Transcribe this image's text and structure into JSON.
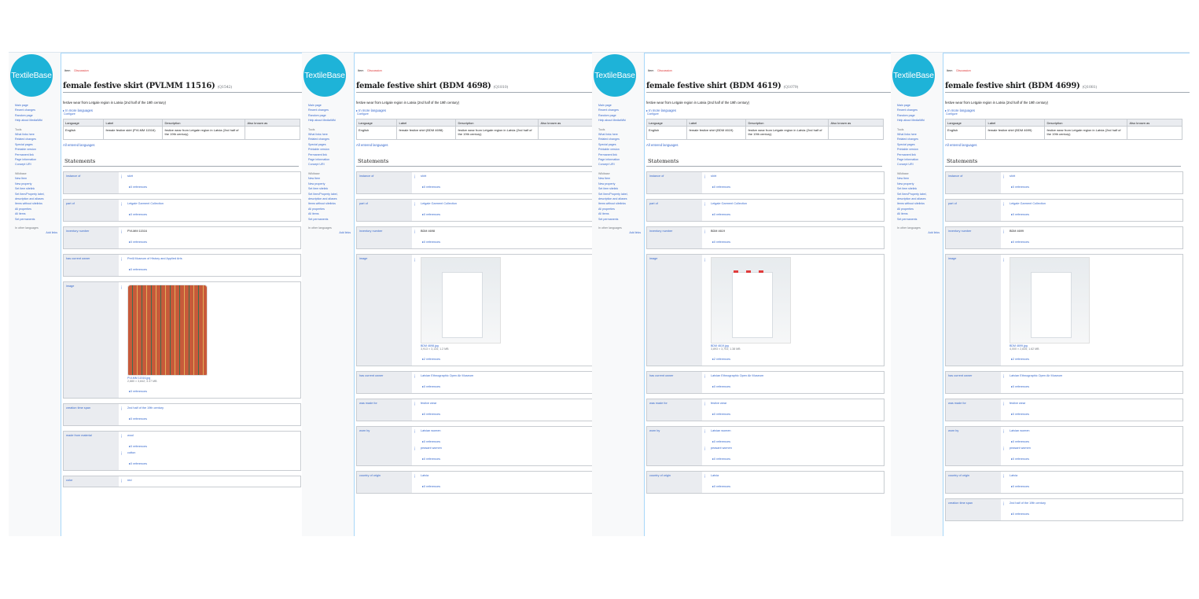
{
  "sidebar": {
    "logo": "TextileBase",
    "nav": [
      "Main page",
      "Recent changes",
      "Random page",
      "Help about MediaWiki"
    ],
    "tools_heading": "Tools",
    "tools": [
      "What links here",
      "Related changes",
      "Special pages",
      "Printable version",
      "Permanent link",
      "Page information",
      "Concept URI"
    ],
    "wikibase_heading": "Wikibase",
    "wikibase": [
      "New Item",
      "New property",
      "Set item sitelink",
      "Set Item/Property label, description and aliases",
      "Items without sitelinks",
      "All properties",
      "All items",
      "Set permanents"
    ],
    "languages_heading": "In other languages",
    "add_links": "Add links"
  },
  "tabs": [
    "Item",
    "Discussion"
  ],
  "labels": {
    "in_more_languages": "In more languages",
    "configure": "Configure",
    "col_language": "Language",
    "col_label": "Label",
    "col_description": "Description",
    "col_aliases": "Also known as",
    "all_entered": "All entered languages",
    "statements": "Statements"
  },
  "pages": [
    {
      "title": "female festive skirt (PVLMM 11516)",
      "qid": "(Q1542)",
      "description": "festive wear from Letgale region in Latvia (2nd half of the 19th century)",
      "terms_row": {
        "language": "English",
        "label": "female festive skirt (PVLMM 11516)",
        "description": "festive wear from Letgale region in Latvia (2nd half of the 19th century)"
      },
      "statements": [
        {
          "property": "instance of",
          "values": [
            {
              "value": "skirt",
              "refs": "0 references"
            }
          ]
        },
        {
          "property": "part of",
          "values": [
            {
              "value": "Letgale Garment Collection",
              "refs": "0 references"
            }
          ]
        },
        {
          "property": "inventory number",
          "values": [
            {
              "value": "PVLMM 11516",
              "plain": true,
              "refs": "0 references"
            }
          ]
        },
        {
          "property": "has current owner",
          "values": [
            {
              "value": "Preiļi Museum of History and Applied Arts",
              "refs": "0 references"
            }
          ]
        },
        {
          "property": "image",
          "values": [
            {
              "image": "skirt",
              "file": "PVLMM 11516.jpg",
              "size": "2,880 × 3,842; 3.37 MB",
              "refs": "0 references"
            }
          ]
        },
        {
          "property": "creation time span",
          "values": [
            {
              "value": "2nd half of the 19th century",
              "refs": "0 references"
            }
          ]
        },
        {
          "property": "made from material",
          "values": [
            {
              "value": "wool",
              "refs": "0 references"
            },
            {
              "value": "cotton",
              "refs": "0 references"
            }
          ]
        },
        {
          "property": "color",
          "values": [
            {
              "value": "red",
              "refs": ""
            }
          ]
        }
      ]
    },
    {
      "title": "female festive shirt (BDM 4698)",
      "qid": "(Q1810)",
      "description": "festive wear from Letgale region in Latvia (2nd half of the 19th century)",
      "terms_row": {
        "language": "English",
        "label": "female festive shirt (BDM 4698)",
        "description": "festive wear from Letgale region in Latvia (2nd half of the 19th century)"
      },
      "statements": [
        {
          "property": "instance of",
          "values": [
            {
              "value": "shirt",
              "refs": "0 references"
            }
          ]
        },
        {
          "property": "part of",
          "values": [
            {
              "value": "Letgale Garment Collection",
              "refs": "0 references"
            }
          ]
        },
        {
          "property": "inventory number",
          "values": [
            {
              "value": "BDM 4698",
              "plain": true,
              "refs": "0 references"
            }
          ]
        },
        {
          "property": "image",
          "values": [
            {
              "image": "shirt",
              "file": "BDM 4698.jpg",
              "size": "3,913 × 3,134; 1.2 MB",
              "refs": "2 references"
            }
          ]
        },
        {
          "property": "has current owner",
          "values": [
            {
              "value": "Latvian Ethnographic Open Air Museum",
              "refs": "0 references"
            }
          ]
        },
        {
          "property": "was made for",
          "values": [
            {
              "value": "festive wear",
              "refs": "0 references"
            }
          ]
        },
        {
          "property": "worn by",
          "values": [
            {
              "value": "Latvian women",
              "refs": "0 references"
            },
            {
              "value": "peasant women",
              "refs": "0 references"
            }
          ]
        },
        {
          "property": "country of origin",
          "values": [
            {
              "value": "Latvia",
              "refs": "0 references"
            }
          ]
        }
      ]
    },
    {
      "title": "female festive shirt (BDM 4619)",
      "qid": "(Q1079)",
      "description": "festive wear from Letgale region in Latvia (2nd half of the 19th century)",
      "terms_row": {
        "language": "English",
        "label": "female festive shirt (BDM 4619)",
        "description": "festive wear from Letgale region in Latvia (2nd half of the 19th century)"
      },
      "statements": [
        {
          "property": "instance of",
          "values": [
            {
              "value": "shirt",
              "refs": "0 references"
            }
          ]
        },
        {
          "property": "part of",
          "values": [
            {
              "value": "Letgale Garment Collection",
              "refs": "0 references"
            }
          ]
        },
        {
          "property": "inventory number",
          "values": [
            {
              "value": "BDM 4619",
              "plain": true,
              "refs": "0 references"
            }
          ]
        },
        {
          "property": "image",
          "values": [
            {
              "image": "shirt-red",
              "file": "BDM 4619.jpg",
              "size": "3,893 × 3,703; 1.38 MB",
              "refs": "2 references"
            }
          ]
        },
        {
          "property": "has current owner",
          "values": [
            {
              "value": "Latvian Ethnographic Open Air Museum",
              "refs": "0 references"
            }
          ]
        },
        {
          "property": "was made for",
          "values": [
            {
              "value": "festive wear",
              "refs": "0 references"
            }
          ]
        },
        {
          "property": "worn by",
          "values": [
            {
              "value": "Latvian women",
              "refs": "0 references"
            },
            {
              "value": "peasant women",
              "refs": "0 references"
            }
          ]
        },
        {
          "property": "country of origin",
          "values": [
            {
              "value": "Latvia",
              "refs": "0 references"
            }
          ]
        }
      ]
    },
    {
      "title": "female festive shirt (BDM 4699)",
      "qid": "(Q1081)",
      "description": "festive wear from Letgale region in Latvia (2nd half of the 19th century)",
      "terms_row": {
        "language": "English",
        "label": "female festive shirt (BDM 4699)",
        "description": "festive wear from Letgale region in Latvia (2nd half of the 19th century)"
      },
      "statements": [
        {
          "property": "instance of",
          "values": [
            {
              "value": "shirt",
              "refs": "0 references"
            }
          ]
        },
        {
          "property": "part of",
          "values": [
            {
              "value": "Letgale Garment Collection",
              "refs": "0 references"
            }
          ]
        },
        {
          "property": "inventory number",
          "values": [
            {
              "value": "BDM 4699",
              "plain": true,
              "refs": "0 references"
            }
          ]
        },
        {
          "property": "image",
          "values": [
            {
              "image": "shirt",
              "file": "BDM 4699.jpg",
              "size": "4,000 × 2,835; 1.62 MB",
              "refs": "2 references"
            }
          ]
        },
        {
          "property": "has current owner",
          "values": [
            {
              "value": "Latvian Ethnographic Open Air Museum",
              "refs": "0 references"
            }
          ]
        },
        {
          "property": "was made for",
          "values": [
            {
              "value": "festive wear",
              "refs": "0 references"
            }
          ]
        },
        {
          "property": "worn by",
          "values": [
            {
              "value": "Latvian women",
              "refs": "0 references"
            },
            {
              "value": "peasant women",
              "refs": "0 references"
            }
          ]
        },
        {
          "property": "country of origin",
          "values": [
            {
              "value": "Latvia",
              "refs": "0 references"
            }
          ]
        },
        {
          "property": "creation time span",
          "values": [
            {
              "value": "2nd half of the 19th century",
              "refs": "0 references"
            }
          ]
        }
      ]
    }
  ]
}
